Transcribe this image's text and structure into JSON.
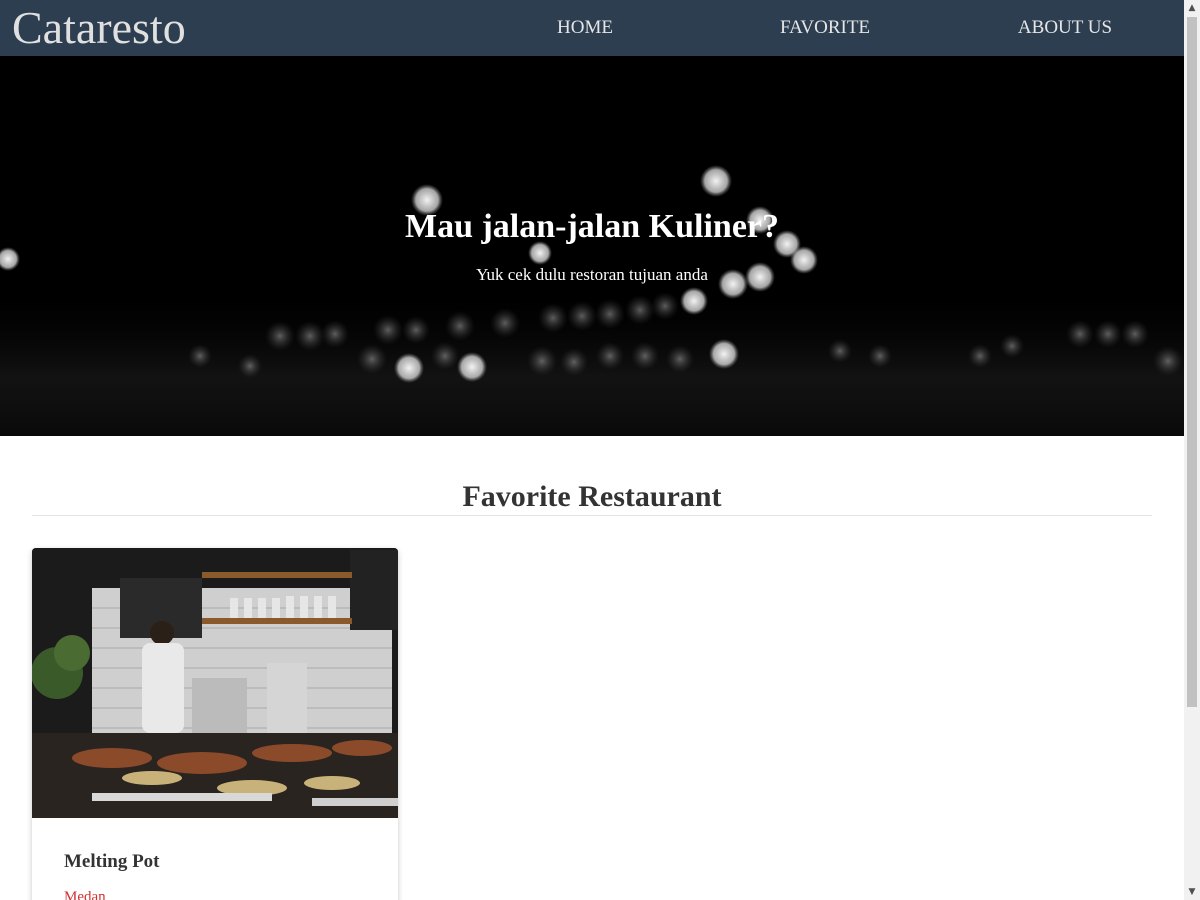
{
  "header": {
    "brand": "Cataresto",
    "nav": [
      {
        "label": "HOME"
      },
      {
        "label": "FAVORITE"
      },
      {
        "label": "ABOUT US"
      }
    ]
  },
  "hero": {
    "title": "Mau jalan-jalan Kuliner?",
    "subtitle": "Yuk cek dulu restoran tujuan anda"
  },
  "main": {
    "section_title": "Favorite Restaurant",
    "restaurants": [
      {
        "name": "Melting Pot",
        "city": "Medan"
      }
    ]
  },
  "colors": {
    "navbar": "#2c3e50",
    "city_text": "#d32f2f"
  }
}
